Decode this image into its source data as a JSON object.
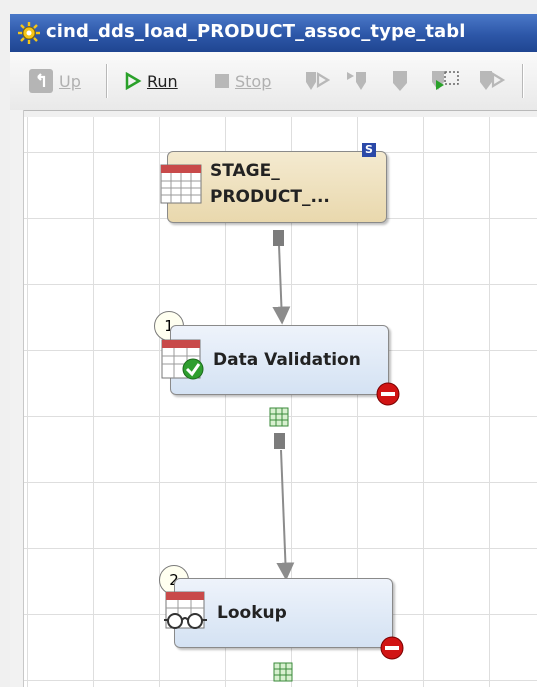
{
  "window": {
    "title": "cind_dds_load_PRODUCT_assoc_type_tabl"
  },
  "toolbar": {
    "up_label": "Up",
    "run_label": "Run",
    "stop_label": "Stop"
  },
  "nodes": {
    "stage": {
      "line1": "STAGE_",
      "line2": "PRODUCT_...",
      "badge": "S"
    },
    "validation": {
      "number": "1",
      "label": "Data Validation"
    },
    "lookup": {
      "number": "2",
      "label": "Lookup"
    }
  },
  "colors": {
    "titlebar": "#2d57a8",
    "run": "#2aa12a",
    "stop_marker": "#c80000"
  }
}
